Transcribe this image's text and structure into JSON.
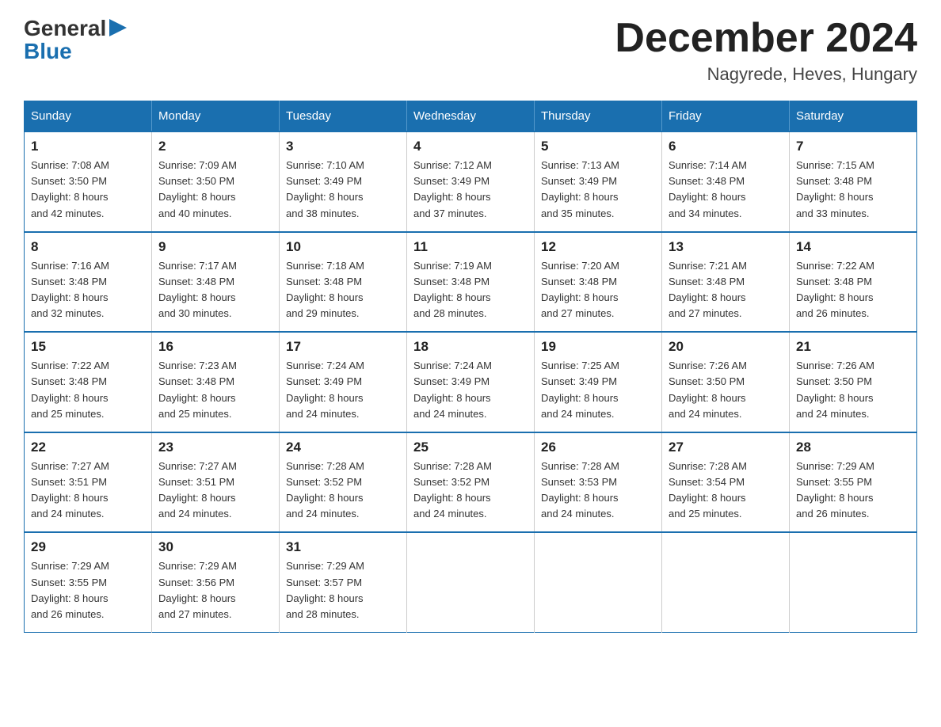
{
  "header": {
    "logo_general": "General",
    "logo_blue": "Blue",
    "month_title": "December 2024",
    "location": "Nagyrede, Heves, Hungary"
  },
  "days_of_week": [
    "Sunday",
    "Monday",
    "Tuesday",
    "Wednesday",
    "Thursday",
    "Friday",
    "Saturday"
  ],
  "weeks": [
    [
      {
        "day": "1",
        "sunrise": "7:08 AM",
        "sunset": "3:50 PM",
        "daylight": "8 hours and 42 minutes."
      },
      {
        "day": "2",
        "sunrise": "7:09 AM",
        "sunset": "3:50 PM",
        "daylight": "8 hours and 40 minutes."
      },
      {
        "day": "3",
        "sunrise": "7:10 AM",
        "sunset": "3:49 PM",
        "daylight": "8 hours and 38 minutes."
      },
      {
        "day": "4",
        "sunrise": "7:12 AM",
        "sunset": "3:49 PM",
        "daylight": "8 hours and 37 minutes."
      },
      {
        "day": "5",
        "sunrise": "7:13 AM",
        "sunset": "3:49 PM",
        "daylight": "8 hours and 35 minutes."
      },
      {
        "day": "6",
        "sunrise": "7:14 AM",
        "sunset": "3:48 PM",
        "daylight": "8 hours and 34 minutes."
      },
      {
        "day": "7",
        "sunrise": "7:15 AM",
        "sunset": "3:48 PM",
        "daylight": "8 hours and 33 minutes."
      }
    ],
    [
      {
        "day": "8",
        "sunrise": "7:16 AM",
        "sunset": "3:48 PM",
        "daylight": "8 hours and 32 minutes."
      },
      {
        "day": "9",
        "sunrise": "7:17 AM",
        "sunset": "3:48 PM",
        "daylight": "8 hours and 30 minutes."
      },
      {
        "day": "10",
        "sunrise": "7:18 AM",
        "sunset": "3:48 PM",
        "daylight": "8 hours and 29 minutes."
      },
      {
        "day": "11",
        "sunrise": "7:19 AM",
        "sunset": "3:48 PM",
        "daylight": "8 hours and 28 minutes."
      },
      {
        "day": "12",
        "sunrise": "7:20 AM",
        "sunset": "3:48 PM",
        "daylight": "8 hours and 27 minutes."
      },
      {
        "day": "13",
        "sunrise": "7:21 AM",
        "sunset": "3:48 PM",
        "daylight": "8 hours and 27 minutes."
      },
      {
        "day": "14",
        "sunrise": "7:22 AM",
        "sunset": "3:48 PM",
        "daylight": "8 hours and 26 minutes."
      }
    ],
    [
      {
        "day": "15",
        "sunrise": "7:22 AM",
        "sunset": "3:48 PM",
        "daylight": "8 hours and 25 minutes."
      },
      {
        "day": "16",
        "sunrise": "7:23 AM",
        "sunset": "3:48 PM",
        "daylight": "8 hours and 25 minutes."
      },
      {
        "day": "17",
        "sunrise": "7:24 AM",
        "sunset": "3:49 PM",
        "daylight": "8 hours and 24 minutes."
      },
      {
        "day": "18",
        "sunrise": "7:24 AM",
        "sunset": "3:49 PM",
        "daylight": "8 hours and 24 minutes."
      },
      {
        "day": "19",
        "sunrise": "7:25 AM",
        "sunset": "3:49 PM",
        "daylight": "8 hours and 24 minutes."
      },
      {
        "day": "20",
        "sunrise": "7:26 AM",
        "sunset": "3:50 PM",
        "daylight": "8 hours and 24 minutes."
      },
      {
        "day": "21",
        "sunrise": "7:26 AM",
        "sunset": "3:50 PM",
        "daylight": "8 hours and 24 minutes."
      }
    ],
    [
      {
        "day": "22",
        "sunrise": "7:27 AM",
        "sunset": "3:51 PM",
        "daylight": "8 hours and 24 minutes."
      },
      {
        "day": "23",
        "sunrise": "7:27 AM",
        "sunset": "3:51 PM",
        "daylight": "8 hours and 24 minutes."
      },
      {
        "day": "24",
        "sunrise": "7:28 AM",
        "sunset": "3:52 PM",
        "daylight": "8 hours and 24 minutes."
      },
      {
        "day": "25",
        "sunrise": "7:28 AM",
        "sunset": "3:52 PM",
        "daylight": "8 hours and 24 minutes."
      },
      {
        "day": "26",
        "sunrise": "7:28 AM",
        "sunset": "3:53 PM",
        "daylight": "8 hours and 24 minutes."
      },
      {
        "day": "27",
        "sunrise": "7:28 AM",
        "sunset": "3:54 PM",
        "daylight": "8 hours and 25 minutes."
      },
      {
        "day": "28",
        "sunrise": "7:29 AM",
        "sunset": "3:55 PM",
        "daylight": "8 hours and 26 minutes."
      }
    ],
    [
      {
        "day": "29",
        "sunrise": "7:29 AM",
        "sunset": "3:55 PM",
        "daylight": "8 hours and 26 minutes."
      },
      {
        "day": "30",
        "sunrise": "7:29 AM",
        "sunset": "3:56 PM",
        "daylight": "8 hours and 27 minutes."
      },
      {
        "day": "31",
        "sunrise": "7:29 AM",
        "sunset": "3:57 PM",
        "daylight": "8 hours and 28 minutes."
      },
      null,
      null,
      null,
      null
    ]
  ],
  "labels": {
    "sunrise": "Sunrise:",
    "sunset": "Sunset:",
    "daylight": "Daylight:"
  }
}
